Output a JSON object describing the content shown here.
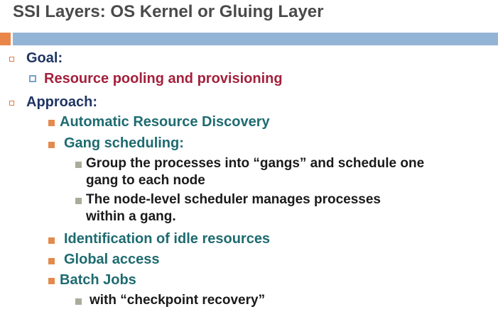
{
  "slide": {
    "title": "SSI Layers: OS Kernel or Gluing Layer",
    "goal": {
      "label": "Goal:",
      "item": "Resource pooling and provisioning"
    },
    "approach": {
      "label": "Approach:",
      "auto_discovery": "Automatic Resource Discovery",
      "gang_scheduling": "Gang scheduling:",
      "gang_point1_line1": "Group the processes into “gangs” and schedule one",
      "gang_point1_line2": "gang to each node",
      "gang_point2_line1": "The node-level scheduler manages processes",
      "gang_point2_line2": "within a gang.",
      "idle_resources": "Identification of idle resources",
      "global_access": "Global access",
      "batch_jobs": "Batch Jobs",
      "batch_point": "with “checkpoint recovery”"
    }
  },
  "colors": {
    "title": "#4a4a4a",
    "level1": "#1f3564",
    "goal_item": "#a3203c",
    "level2": "#1e6b70",
    "level3": "#1a1a1a",
    "accent_orange": "#e9874a",
    "band_blue": "#94b4d6",
    "bullet_gray": "#a8ad9a"
  }
}
